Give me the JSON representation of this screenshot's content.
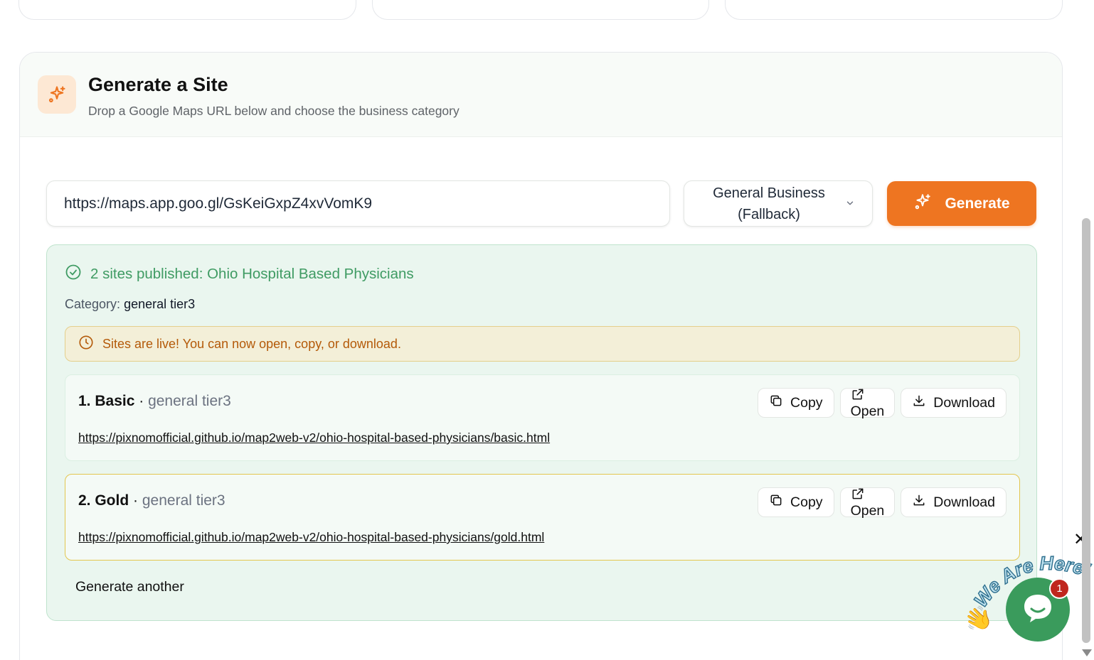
{
  "header": {
    "title": "Generate a Site",
    "subtitle": "Drop a Google Maps URL below and choose the business category"
  },
  "form": {
    "url_value": "https://maps.app.goo.gl/GsKeiGxpZ4xvVomK9",
    "category_line1": "General Business",
    "category_line2": "(Fallback)",
    "generate_label": "Generate"
  },
  "result": {
    "title": "2 sites published: Ohio Hospital Based Physicians",
    "category_label": "Category:",
    "category_value": "general tier3",
    "live_message": "Sites are live! You can now open, copy, or download.",
    "sites": [
      {
        "name": "1. Basic",
        "separator": " · ",
        "tier": "general tier3",
        "url": "https://pixnomofficial.github.io/map2web-v2/ohio-hospital-based-physicians/basic.html",
        "copy_label": "Copy",
        "open_label": "Open",
        "download_label": "Download"
      },
      {
        "name": "2. Gold",
        "separator": " · ",
        "tier": "general tier3",
        "url": "https://pixnomofficial.github.io/map2web-v2/ohio-hospital-based-physicians/gold.html",
        "copy_label": "Copy",
        "open_label": "Open",
        "download_label": "Download"
      }
    ],
    "generate_another_label": "Generate another"
  },
  "chat": {
    "badge_count": "1",
    "banner_text": "We Are Here!",
    "close_symbol": "✕"
  },
  "colors": {
    "accent": "#ee7521",
    "success": "#3f9b63",
    "warning_text": "#b45a09",
    "chat": "#3a9b5c"
  }
}
